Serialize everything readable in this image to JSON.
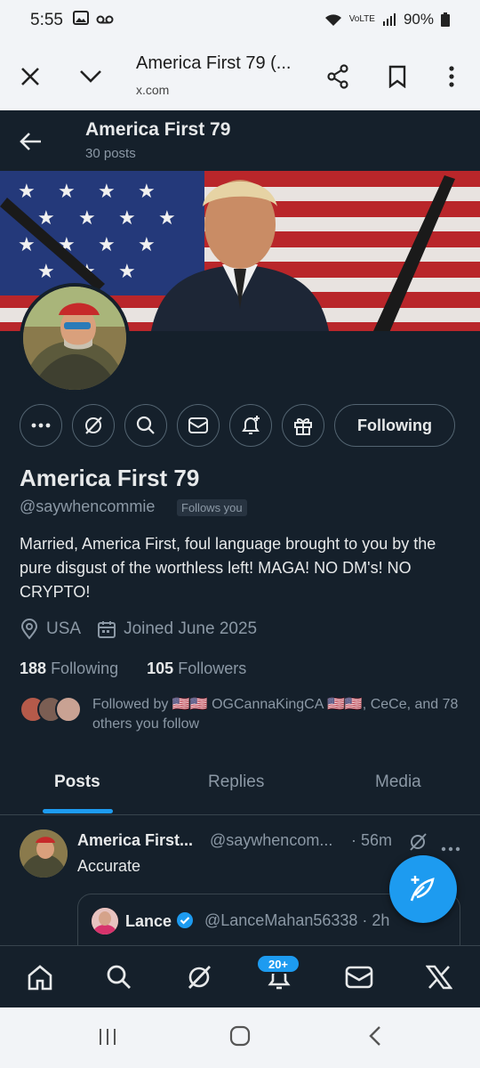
{
  "status_bar": {
    "time": "5:55",
    "icons": [
      "gallery-icon",
      "voicemail-icon"
    ],
    "network": "VoLTE",
    "battery": "90%"
  },
  "browser": {
    "title": "America First 79 (...",
    "url": "x.com"
  },
  "header": {
    "name": "America First 79",
    "posts": "30 posts"
  },
  "profile": {
    "name": "America First 79",
    "handle": "@saywhencommie",
    "follows_you": "Follows you",
    "bio": "Married, America First, foul language brought to you by the pure disgust of the worthless left!  MAGA! NO DM's!  NO CRYPTO!",
    "location": "USA",
    "joined": "Joined June 2025",
    "following_count": "188",
    "following_label": "Following",
    "followers_count": "105",
    "followers_label": "Followers",
    "followed_by": "Followed by 🇺🇸🇺🇸 OGCannaKingCA 🇺🇸🇺🇸, CeCe, and 78 others you follow",
    "following_button": "Following"
  },
  "tabs": [
    "Posts",
    "Replies",
    "Media"
  ],
  "post": {
    "name": "America First...",
    "handle": "@saywhencom...",
    "time": "· 56m",
    "text": "Accurate",
    "quote": {
      "name": "Lance",
      "handle": "@LanceMahan56338",
      "time": "· 2h"
    }
  },
  "bottom_nav": {
    "notification_badge": "20+"
  },
  "colors": {
    "background": "#15202b",
    "accent": "#1d9bf0",
    "secondary_text": "#8b98a5"
  }
}
